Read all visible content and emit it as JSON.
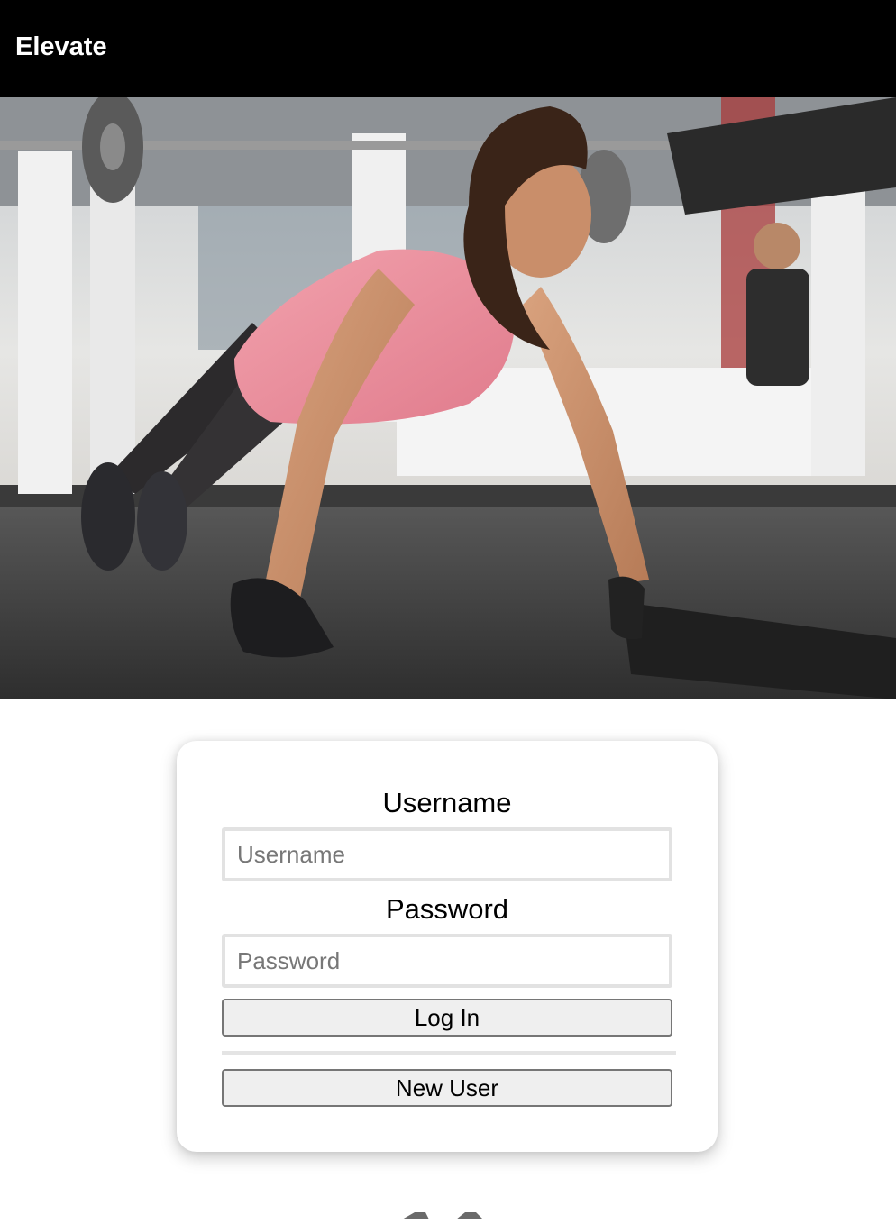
{
  "header": {
    "brand": "Elevate",
    "background_color": "#000000"
  },
  "hero": {
    "icon": "hero-photo"
  },
  "login": {
    "username_label": "Username",
    "username_placeholder": "Username",
    "username_value": "",
    "password_label": "Password",
    "password_placeholder": "Password",
    "password_value": "",
    "login_button": "Log In",
    "new_user_button": "New User"
  },
  "colors": {
    "input_border": "#e2e2e2",
    "button_background": "#efefef",
    "button_border": "#767676"
  }
}
